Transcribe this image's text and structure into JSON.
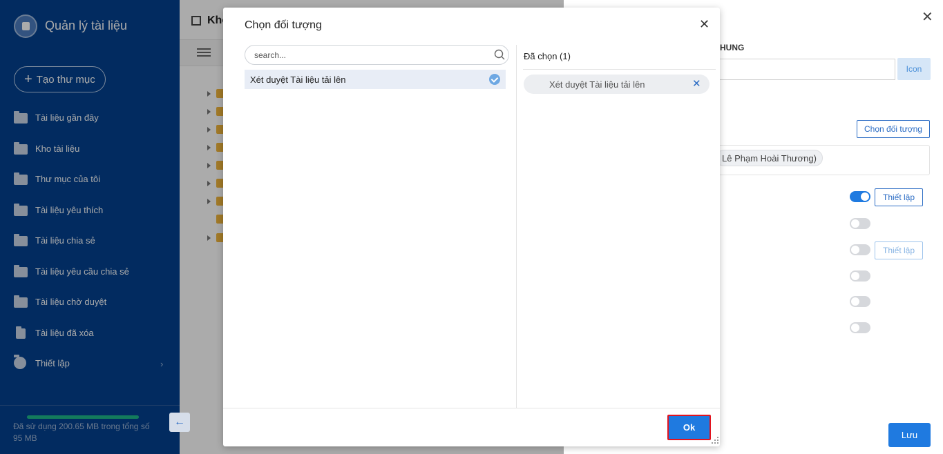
{
  "sidebar": {
    "app_title": "Quản lý tài liệu",
    "new_folder_label": "Tạo thư mục",
    "items": [
      {
        "label": "Tài liệu gần đây",
        "icon": "recent-folder-icon"
      },
      {
        "label": "Kho tài liệu",
        "icon": "repository-icon"
      },
      {
        "label": "Thư mục của tôi",
        "icon": "my-folder-icon"
      },
      {
        "label": "Tài liệu yêu thích",
        "icon": "favorite-folder-icon"
      },
      {
        "label": "Tài liệu chia sẻ",
        "icon": "shared-folder-icon"
      },
      {
        "label": "Tài liệu yêu cầu chia sẻ",
        "icon": "share-request-icon"
      },
      {
        "label": "Tài liệu chờ duyệt",
        "icon": "pending-folder-icon"
      },
      {
        "label": "Tài liệu đã xóa",
        "icon": "trash-icon"
      },
      {
        "label": "Thiết lập",
        "icon": "gear-icon"
      }
    ],
    "storage_text": "Đã sử dụng 200.65 MB trong tổng số 95 MB",
    "storage_fraction": 1.0
  },
  "main": {
    "breadcrumb": "Kho"
  },
  "right_panel": {
    "section_label": "HUNG",
    "icon_button_label": "Icon",
    "choose_button_label": "Chọn đối tượng",
    "chosen_person": "Lê Phạm Hoài Thương)",
    "set_button_label": "Thiết lập",
    "set_button_disabled_label": "Thiết lập",
    "toggles": [
      true,
      false,
      false,
      false,
      false,
      false
    ],
    "save_label": "Lưu"
  },
  "modal": {
    "title": "Chọn đối tượng",
    "search_placeholder": "search...",
    "list_items": [
      "Xét duyệt Tài liệu tải lên"
    ],
    "selected_title": "Đã chọn (1)",
    "selected_items": [
      "Xét duyệt Tài liệu tải lên"
    ],
    "ok_label": "Ok"
  },
  "colors": {
    "sidebar_bg": "#03408f",
    "accent": "#1f7ae0",
    "highlight_border": "#e2141f"
  }
}
